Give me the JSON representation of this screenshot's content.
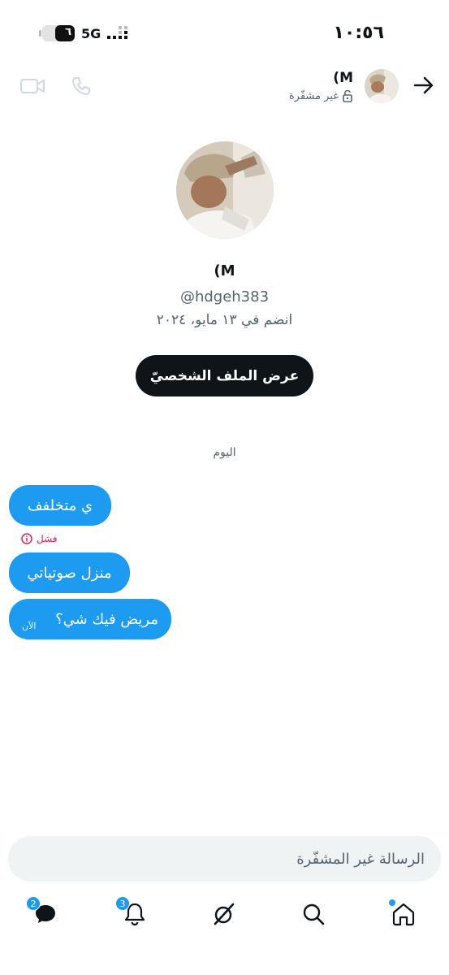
{
  "status_bar": {
    "time": "١٠:٥٦",
    "network": "5G",
    "battery_label": "٦",
    "battery_level": 0.6
  },
  "header": {
    "name": "M)",
    "encryption_status": "غير مشفّرة"
  },
  "profile": {
    "name": "M)",
    "handle": "@hdgeh383",
    "joined": "انضم في ١٣ مايو، ٢٠٢٤",
    "view_profile_button": "عرض الملف الشخصيّ"
  },
  "conversation": {
    "day_label": "اليوم",
    "messages": [
      {
        "text": "ي متخلفف"
      },
      {
        "text": "منزل صوتياتي"
      },
      {
        "text": "مريض فيك شي؟",
        "time": "الآن"
      }
    ],
    "failed_label": "فشل"
  },
  "composer": {
    "placeholder": "الرسالة غير المشفّرة"
  },
  "bottom_nav": {
    "messages_badge": "2",
    "notifications_badge": "3",
    "icons": [
      "home-icon",
      "search-icon",
      "grok-icon",
      "notifications-icon",
      "messages-icon"
    ]
  },
  "colors": {
    "accent": "#1d9bf0",
    "primary_button": "#0f1419",
    "error": "#e0245e",
    "secondary_text": "#536471"
  }
}
